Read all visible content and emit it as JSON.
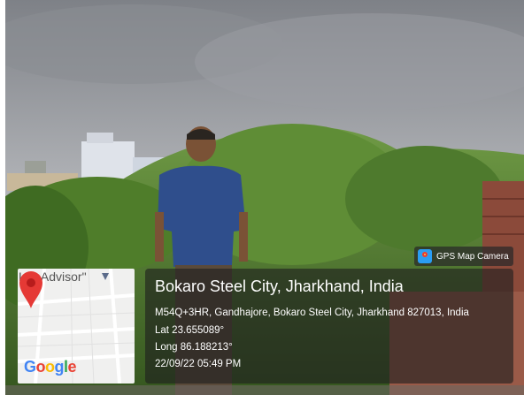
{
  "photo": {
    "subject": "man-standing-on-rooftop",
    "colors": {
      "sky": "#b9bbbe",
      "foliage": "#5c8a3a",
      "shirt": "#2f4e8c"
    }
  },
  "badge": {
    "label": "GPS Map Camera",
    "icon": "gps-map-camera-icon"
  },
  "location": {
    "place": "Bokaro Steel City, Jharkhand, India",
    "address": "M54Q+3HR, Gandhajore, Bokaro Steel City, Jharkhand 827013, India",
    "lat": "Lat 23.655089°",
    "long": "Long 86.188213°",
    "datetime": "22/09/22 05:49 PM"
  },
  "map": {
    "title": "LIC Advisor\"",
    "brand": "Google",
    "pin_color": "#e53935",
    "brand_colors": [
      "#4285F4",
      "#EA4335",
      "#FBBC05",
      "#4285F4",
      "#34A853",
      "#EA4335"
    ]
  }
}
